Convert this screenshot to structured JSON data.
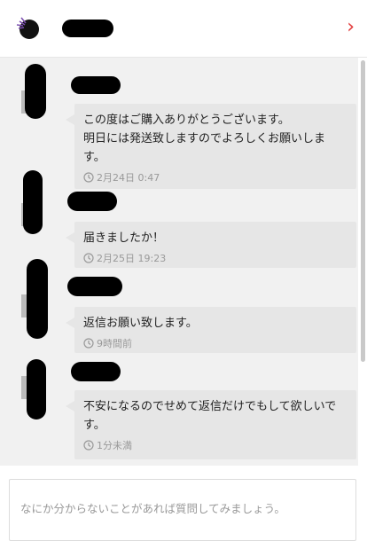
{
  "header": {
    "chevron_icon": "chevron-right-icon"
  },
  "messages": [
    {
      "text": "この度はご購入ありがとうございます。\n明日には発送致しますのでよろしくお願いしま\nす。",
      "time": "2月24日 0:47"
    },
    {
      "text": "届きましたか！",
      "time": "2月25日 19:23"
    },
    {
      "text": "返信お願い致します。",
      "time": "9時間前"
    },
    {
      "text": "不安になるのでせめて返信だけでもして欲しいで\nす。",
      "time": "1分未満"
    }
  ],
  "composer": {
    "placeholder": "なにか分からないことがあれば質問してみましょう。",
    "value": ""
  },
  "colors": {
    "accent": "#e23b3b",
    "chat_background": "#f1f1f1",
    "bubble": "#e6e6e6",
    "timestamp": "#999999"
  }
}
